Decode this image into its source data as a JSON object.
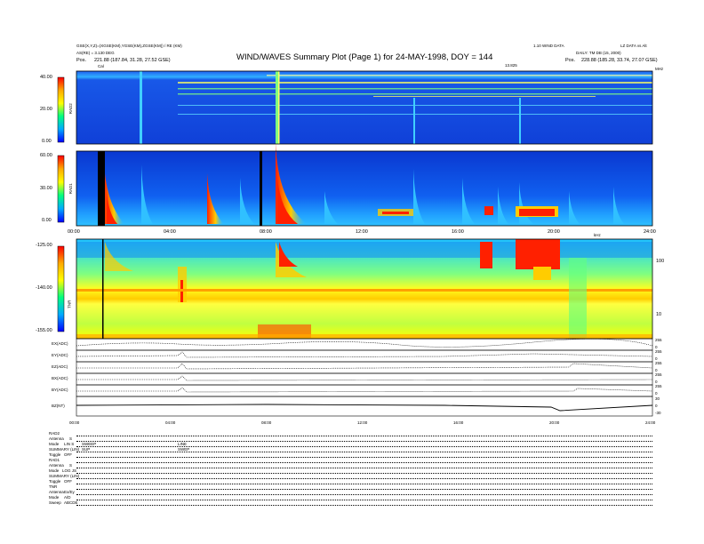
{
  "header": {
    "title": "WIND/WAVES Summary Plot (Page 1) for 24-MAY-1998, DOY = 144",
    "left_line1": "GSE(X,Y,Z)=(XGSE(KM),YGSE(KM),ZGSE(KM)) / RE (KM)",
    "left_line2": "AS(RE) = 3.130 DEG",
    "left_pos_label": "Pos.",
    "left_pos_value": "221.88 (187.84, 31.28, 27.52 GSE)",
    "right_line1": "1.10 WIND DATA",
    "right_line2": "LZ DATA vs Alt",
    "right_line3": "DAILY: TM DB (15, 2000)",
    "right_pos_label": "Pos.",
    "right_pos_value": "228.88 (185.28, 33.74, 27.07 GSE)",
    "cal_label": "Cal"
  },
  "colors": {
    "background_spectrum": "#1050e0",
    "high_intensity": "#ff2000",
    "axis": "#000000"
  },
  "chart_data": [
    {
      "type": "heatmap",
      "panel": "RAD2",
      "ylabel": "RAD2",
      "colorbar_ticks": [
        "40.00",
        "20.00",
        "0.00"
      ],
      "right_tick": "MHz",
      "right_top_label": "13.825"
    },
    {
      "type": "heatmap",
      "panel": "RAD1",
      "ylabel": "RAD1",
      "colorbar_ticks": [
        "60.00",
        "30.00",
        "0.00"
      ],
      "x_ticks": [
        "00:00",
        "04:00",
        "08:00",
        "12:00",
        "16:00",
        "20:00",
        "24:00"
      ],
      "xlim": [
        "00:00",
        "24:00"
      ]
    },
    {
      "type": "heatmap",
      "panel": "TNR",
      "ylabel": "TNR",
      "colorbar_ticks": [
        "-125.00",
        "-140.00",
        "-155.00"
      ],
      "right_ticks": [
        "100",
        "10"
      ],
      "right_label": "kHz"
    },
    {
      "type": "line",
      "panel": "waveform channels",
      "series": [
        {
          "name": "EX(ADC)",
          "right_ticks": [
            "255",
            "0"
          ]
        },
        {
          "name": "EY(ADC)",
          "right_ticks": [
            "255",
            "0"
          ]
        },
        {
          "name": "EZ(ADC)",
          "right_ticks": [
            "255",
            "0"
          ]
        },
        {
          "name": "BX(ADC)",
          "right_ticks": [
            "255",
            "0"
          ]
        },
        {
          "name": "BY(ADC)",
          "right_ticks": [
            "255",
            "0"
          ]
        },
        {
          "name": "BZ(NT)",
          "right_ticks": [
            "30",
            "0",
            "-30"
          ]
        }
      ],
      "x_ticks": [
        "00:00",
        "04:00",
        "08:00",
        "12:00",
        "16:00",
        "20:00",
        "24:00"
      ]
    }
  ],
  "footer": {
    "rows": [
      {
        "label": "RAD2",
        "value": ""
      },
      {
        "label": "Antenna",
        "value": "S"
      },
      {
        "label": "Mode",
        "value": "LIN S",
        "col2": "SWEEP",
        "col3": "LINE"
      },
      {
        "label": "SUMMARY (LIN)",
        "value": "",
        "col2": "SUP",
        "col3": "SWEP"
      },
      {
        "label": "Toggle",
        "value": "OFF"
      },
      {
        "label": "RAD1",
        "value": ""
      },
      {
        "label": "Antenna",
        "value": "S"
      },
      {
        "label": "Mode",
        "value": "LOG JS"
      },
      {
        "label": "SUMMARY (LIN)",
        "value": ""
      },
      {
        "label": "Toggle",
        "value": "OFF"
      },
      {
        "label": "TNR",
        "value": ""
      },
      {
        "label": "Antenna",
        "value": "Ex/Ey"
      },
      {
        "label": "Mode",
        "value": "A/D"
      },
      {
        "label": "Sweep",
        "value": "ABCDE"
      }
    ]
  }
}
